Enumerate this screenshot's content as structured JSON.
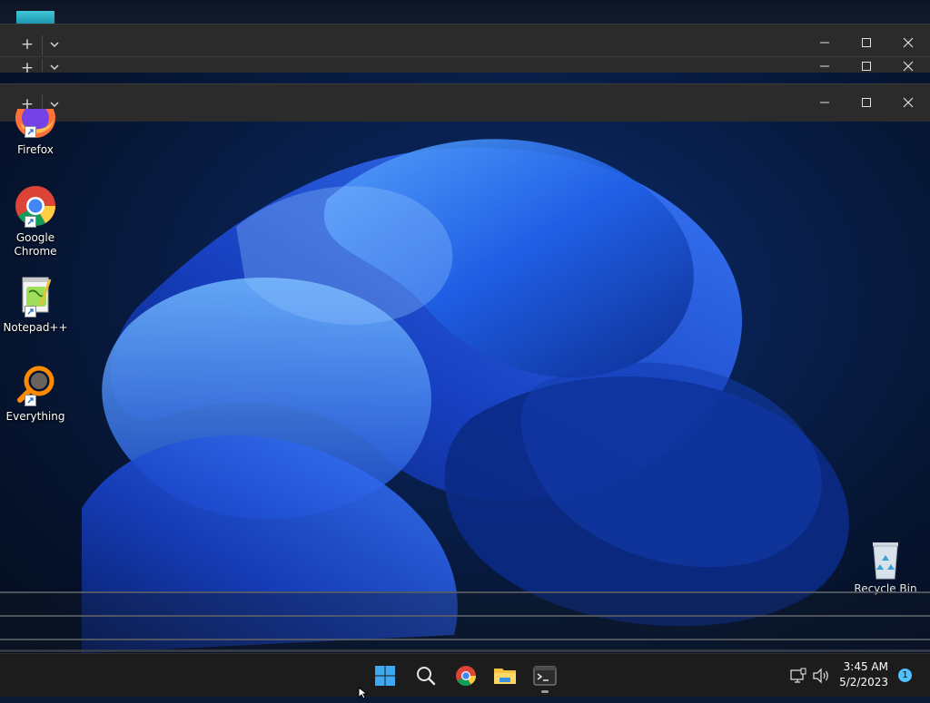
{
  "terminal_windows": [
    {
      "new_tab": "+",
      "controls": [
        "minimize",
        "maximize",
        "close"
      ]
    },
    {
      "new_tab": "+",
      "controls": [
        "minimize",
        "maximize",
        "close"
      ]
    },
    {
      "new_tab": "+",
      "controls": [
        "minimize",
        "maximize",
        "close"
      ]
    }
  ],
  "desktop": {
    "icons": [
      {
        "label": "Firefox",
        "icon": "firefox-icon"
      },
      {
        "label": "Google\nChrome",
        "line1": "Google",
        "line2": "Chrome",
        "icon": "chrome-icon"
      },
      {
        "label": "Notepad++",
        "icon": "notepadpp-icon"
      },
      {
        "label": "Everything",
        "icon": "everything-icon"
      }
    ],
    "recycle_bin": "Recycle Bin"
  },
  "taskbar": {
    "apps": [
      "start-icon",
      "search-icon",
      "chrome-icon",
      "file-explorer-icon",
      "terminal-icon"
    ],
    "time": "3:45 AM",
    "date": "5/2/2023",
    "notification_count": "1"
  },
  "colors": {
    "taskbar_bg": "#1c1c1c",
    "titlebar_bg": "#2b2b2b",
    "accent": "#4cc2ff"
  }
}
